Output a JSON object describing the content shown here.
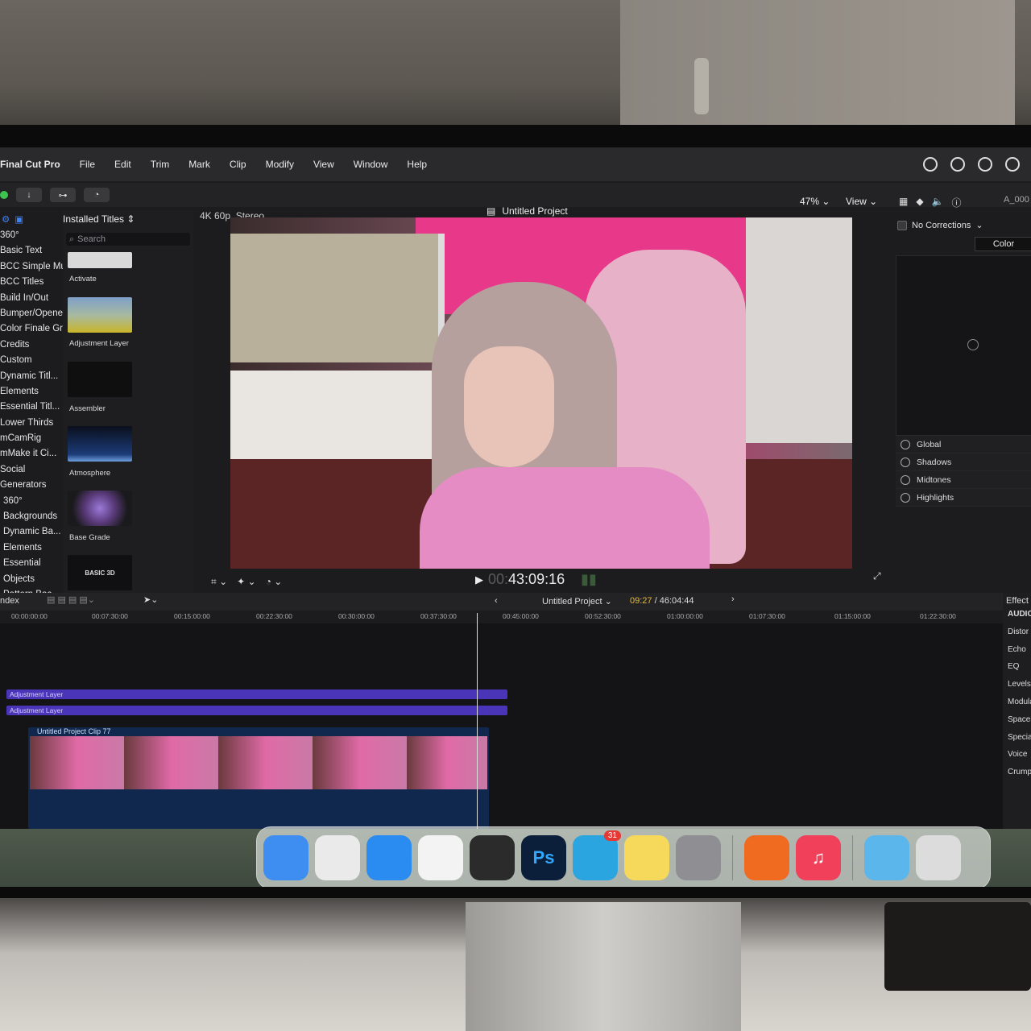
{
  "menubar": {
    "app_name": "Final Cut Pro",
    "items": [
      "File",
      "Edit",
      "Trim",
      "Mark",
      "Clip",
      "Modify",
      "View",
      "Window",
      "Help"
    ]
  },
  "browser": {
    "source": "Installed Titles",
    "search_placeholder": "Search",
    "sidebar_items": [
      "360°",
      "Basic Text",
      "BCC Simple Mu",
      "BCC Titles",
      "Build In/Out",
      "Bumper/Opener",
      "Color Finale Gra",
      "Credits",
      "Custom",
      "Dynamic Titl...",
      "Elements",
      "Essential Titl...",
      "Lower Thirds",
      "mCamRig",
      "mMake it Ci...",
      "Social",
      "Generators",
      "360°",
      "Backgrounds",
      "Dynamic Ba...",
      "Elements",
      "Essential",
      "Objects",
      "Pattern Bac..."
    ],
    "thumbnails": [
      "Activate",
      "Adjustment Layer",
      "Assembler",
      "Atmosphere",
      "Base Grade",
      "BASIC 3D"
    ]
  },
  "viewer": {
    "format": "4K 60p, Stereo",
    "project_title": "Untitled Project",
    "zoom": "47%",
    "view_menu": "View",
    "timecode_dim": "00:",
    "timecode": "43:09:16"
  },
  "inspector": {
    "clip_id": "A_000",
    "corrections": "No Corrections",
    "tab": "Color",
    "zones": [
      "Global",
      "Shadows",
      "Midtones",
      "Highlights"
    ]
  },
  "timeline": {
    "index_label": "ndex",
    "project": "Untitled Project",
    "current_time": "09:27",
    "total_time": "/ 46:04:44",
    "ruler": [
      "00:00:00:00",
      "00:07:30:00",
      "00:15:00:00",
      "00:22:30:00",
      "00:30:00:00",
      "00:37:30:00",
      "00:45:00:00",
      "00:52:30:00",
      "01:00:00:00",
      "01:07:30:00",
      "01:15:00:00",
      "01:22:30:00"
    ],
    "adjustment_layers": [
      "Adjustment Layer",
      "Adjustment Layer"
    ],
    "clip_label": "Untitled Project Clip 77"
  },
  "effects": {
    "header": "Effect",
    "category": "AUDIO",
    "items": [
      "Distor",
      "Echo",
      "EQ",
      "Levels",
      "Modula",
      "Spaces",
      "Specia",
      "Voice",
      "Crump"
    ]
  },
  "dock": {
    "apps": [
      {
        "name": "finder-icon",
        "label": "",
        "color": "#3d8ef0"
      },
      {
        "name": "launchpad-icon",
        "label": "",
        "color": "#eaeaea"
      },
      {
        "name": "safari-icon",
        "label": "",
        "color": "#2a8cf0"
      },
      {
        "name": "chrome-icon",
        "label": "",
        "color": "#f3f3f3"
      },
      {
        "name": "final-cut-pro-icon",
        "label": "",
        "color": "#2b2b2b"
      },
      {
        "name": "photoshop-icon",
        "label": "Ps",
        "color": "#0b1f3a"
      },
      {
        "name": "telegram-icon",
        "label": "",
        "color": "#2aa5e0"
      },
      {
        "name": "notes-icon",
        "label": "",
        "color": "#f6d85a"
      },
      {
        "name": "system-settings-icon",
        "label": "",
        "color": "#8e8e93"
      },
      {
        "name": "origin-icon",
        "label": "",
        "color": "#f06a1f"
      },
      {
        "name": "music-icon",
        "label": "♫",
        "color": "#f0405a"
      },
      {
        "name": "downloads-folder-icon",
        "label": "",
        "color": "#5bb6ec"
      },
      {
        "name": "trash-icon",
        "label": "",
        "color": "#dcdcdc"
      }
    ],
    "telegram_badge": "31"
  }
}
